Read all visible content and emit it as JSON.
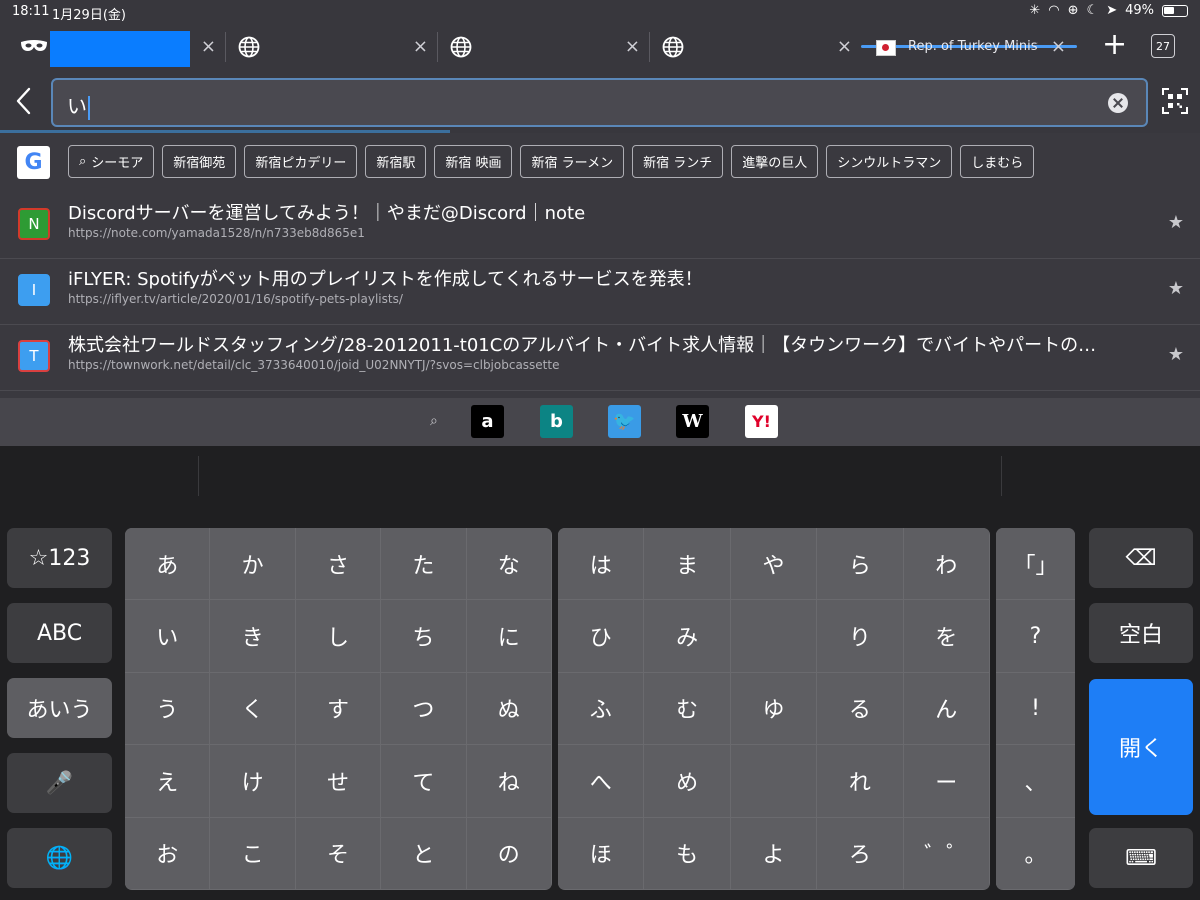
{
  "status": {
    "time": "18:11",
    "date": "1月29日(金)",
    "battery": "49%"
  },
  "tabs": [
    {
      "kind": "private",
      "title": "",
      "close": "×"
    },
    {
      "kind": "globe",
      "title": "",
      "close": "×"
    },
    {
      "kind": "globe",
      "title": "",
      "close": "×"
    },
    {
      "kind": "globe",
      "title": "",
      "close": "×"
    },
    {
      "kind": "site",
      "title": "Rep. of Turkey Minist",
      "close": "×",
      "active": true
    }
  ],
  "tabbar": {
    "new_tab": "+",
    "tab_count": "27"
  },
  "url": {
    "value": "い"
  },
  "suggestions": {
    "chips": [
      "シーモア",
      "新宿御苑",
      "新宿ピカデリー",
      "新宿駅",
      "新宿 映画",
      "新宿 ラーメン",
      "新宿 ランチ",
      "進撃の巨人",
      "シンウルトラマン",
      "しまむら"
    ]
  },
  "history": [
    {
      "letter": "N",
      "fav_bg": "#2e9b34",
      "fav_border": "#d23a2a",
      "title": "Discordサーバーを運営してみよう！｜やまだ@Discord｜note",
      "url": "https://note.com/yamada1528/n/n733eb8d865e1"
    },
    {
      "letter": "I",
      "fav_bg": "#3d9ef0",
      "fav_border": "#3d9ef0",
      "title": "iFLYER: Spotifyがペット用のプレイリストを作成してくれるサービスを発表！",
      "url": "https://iflyer.tv/article/2020/01/16/spotify-pets-playlists/"
    },
    {
      "letter": "T",
      "fav_bg": "#3d9ef0",
      "fav_border": "#d94040",
      "title": "株式会社ワールドスタッフィング/28-2012011-t01Cのアルバイト・バイト求人情報｜【タウンワーク】でバイトやパートの…",
      "url": "https://townwork.net/detail/clc_3733640010/joid_U02NNYTJ/?svos=clbjobcassette"
    }
  ],
  "engines": [
    {
      "name": "amazon-icon",
      "glyph": "a",
      "bg": "#000000",
      "fg": "#ffffff"
    },
    {
      "name": "bing-icon",
      "glyph": "b",
      "bg": "#0c8484",
      "fg": "#ffffff"
    },
    {
      "name": "twitter-icon",
      "glyph": "🐦",
      "bg": "#3a9be6",
      "fg": "#ffffff"
    },
    {
      "name": "wikipedia-icon",
      "glyph": "W",
      "bg": "#000000",
      "fg": "#ffffff"
    },
    {
      "name": "yahoo-icon",
      "glyph": "Y!",
      "bg": "#ffffff",
      "fg": "#e0002a"
    }
  ],
  "keyboard": {
    "left_keys": [
      "☆123",
      "ABC",
      "あいう",
      "🎤",
      "🌐"
    ],
    "kana_left": [
      [
        "あ",
        "か",
        "さ",
        "た",
        "な"
      ],
      [
        "い",
        "き",
        "し",
        "ち",
        "に"
      ],
      [
        "う",
        "く",
        "す",
        "つ",
        "ぬ"
      ],
      [
        "え",
        "け",
        "せ",
        "て",
        "ね"
      ],
      [
        "お",
        "こ",
        "そ",
        "と",
        "の"
      ]
    ],
    "kana_right": [
      [
        "は",
        "ま",
        "や",
        "ら",
        "わ"
      ],
      [
        "ひ",
        "み",
        "",
        "り",
        "を"
      ],
      [
        "ふ",
        "む",
        "ゆ",
        "る",
        "ん"
      ],
      [
        "へ",
        "め",
        "",
        "れ",
        "ー"
      ],
      [
        "ほ",
        "も",
        "よ",
        "ろ",
        "゛゜"
      ]
    ],
    "punct": [
      "「」",
      "?",
      "!",
      "、",
      "。"
    ],
    "delete": "⌫",
    "space": "空白",
    "enter": "開く",
    "hide": "⌨"
  }
}
